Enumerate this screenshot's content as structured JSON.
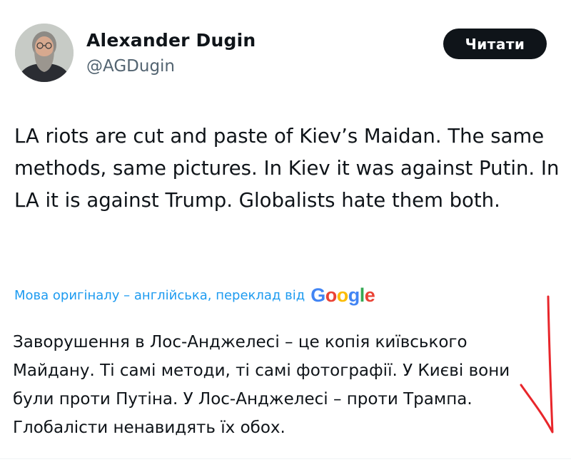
{
  "author": {
    "name": "Alexander Dugin",
    "handle": "@AGDugin"
  },
  "follow_button": {
    "label": "Читати"
  },
  "tweet": {
    "text": "LA riots are cut and paste of Kiev’s Maidan. The same methods, same pictures. In Kiev it was against Putin. In LA it is against Trump. Globalists hate them both."
  },
  "translation": {
    "notice": "Мова оригіналу – англійська, переклад від",
    "provider_letters": [
      {
        "ch": "G",
        "color": "#4285f4"
      },
      {
        "ch": "o",
        "color": "#ea4335"
      },
      {
        "ch": "o",
        "color": "#fbbc05"
      },
      {
        "ch": "g",
        "color": "#4285f4"
      },
      {
        "ch": "l",
        "color": "#34a853"
      },
      {
        "ch": "e",
        "color": "#ea4335"
      }
    ],
    "text": "Заворушення в Лос-Анджелесі – це копія київського Майдану. Ті самі методи, ті самі фотографії. У Києві вони були проти Путіна. У Лос-Анджелесі – проти Трампа. Глобалісти ненавидять їх обох."
  },
  "colors": {
    "text_primary": "#0f1419",
    "text_secondary": "#536471",
    "link_blue": "#1d9bf0",
    "annotation_red": "#e8262b"
  }
}
